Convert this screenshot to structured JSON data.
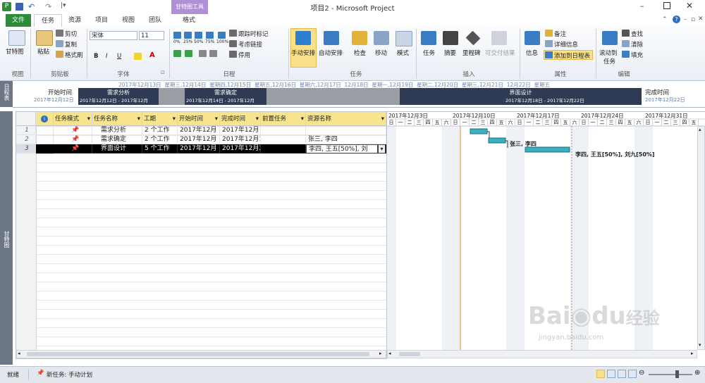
{
  "window": {
    "title": "项目2 - Microsoft Project",
    "contextual_tab_title": "甘特图工具"
  },
  "tabs": [
    "文件",
    "任务",
    "资源",
    "项目",
    "视图",
    "团队",
    "格式"
  ],
  "ribbon": {
    "view": {
      "gantt_label": "甘特图",
      "group": "视图"
    },
    "clipboard": {
      "paste": "粘贴",
      "cut": "剪切",
      "copy": "复制",
      "format_painter": "格式刷",
      "group": "剪贴板"
    },
    "font": {
      "font_name": "宋体",
      "font_size": "11",
      "bold": "B",
      "italic": "I",
      "underline": "U",
      "group": "字体"
    },
    "schedule": {
      "pct": [
        "0%",
        "25%",
        "50%",
        "75%",
        "100%"
      ],
      "track": "跟踪时标记",
      "respect_links": "考虑链接",
      "inactivate": "停用",
      "group": "日程"
    },
    "tasks": {
      "manual": "手动安排",
      "auto": "自动安排",
      "inspect": "检查",
      "move": "移动",
      "mode": "模式",
      "group": "任务"
    },
    "insert": {
      "task": "任务",
      "summary": "摘要",
      "milestone": "里程碑",
      "deliverable": "可交付结果",
      "group": "插入"
    },
    "properties": {
      "info": "信息",
      "notes": "备注",
      "details": "详细信息",
      "add_timeline": "添加到日程表",
      "group": "属性"
    },
    "editing": {
      "scroll_to_task": "滚动到",
      "scroll_to_task2": "任务",
      "find": "查找",
      "clear": "清除",
      "fill": "填充",
      "group": "编辑"
    }
  },
  "timeline": {
    "side_label": "日程表",
    "dates": [
      "2017年12月13日",
      "星期三,12月14日",
      "星期四,12月15日",
      "星期五,12月16日",
      "星期六,12月17日",
      "12月18日",
      "星期一,12月19日",
      "星期二,12月20日",
      "星期三,12月21日",
      "12月22日",
      "星期五"
    ],
    "start_label": "开始时间",
    "start_date": "2017年12月12日",
    "finish_label": "完成时间",
    "finish_date": "2017年12月22日",
    "bars": [
      {
        "name": "需求分析",
        "range": "2017年12月12日 - 2017年12月"
      },
      {
        "name": "需求确定",
        "range": "2017年12月14日 - 2017年12月"
      },
      {
        "name": "界面设计",
        "range": "2017年12月18日 - 2017年12月22日"
      }
    ]
  },
  "view_side_label": "甘特图",
  "table": {
    "headers": [
      "任务模式",
      "任务名称",
      "工期",
      "开始时间",
      "完成时间",
      "前置任务",
      "资源名称"
    ],
    "rows": [
      {
        "id": "1",
        "name": "需求分析",
        "duration": "2 个工作",
        "start": "2017年12月",
        "finish": "2017年12月",
        "pred": "",
        "resources": ""
      },
      {
        "id": "2",
        "name": "需求确定",
        "duration": "2 个工作",
        "start": "2017年12月",
        "finish": "2017年12月1",
        "pred": "",
        "resources": "张三, 李四"
      },
      {
        "id": "3",
        "name": "界面设计",
        "duration": "5 个工作",
        "start": "2017年12月",
        "finish": "2017年12月2",
        "pred": "",
        "resources": "李四, 王五[50%], 刘"
      }
    ]
  },
  "gantt": {
    "weeks": [
      "2017年12月3日",
      "2017年12月10日",
      "2017年12月17日",
      "2017年12月24日",
      "2017年12月31日"
    ],
    "days": [
      "日",
      "一",
      "二",
      "三",
      "四",
      "五",
      "六"
    ],
    "bar_labels": [
      "张三, 李四",
      "李四, 王五[50%], 刘九[50%]"
    ]
  },
  "status": {
    "ready": "就绪",
    "new_task": "新任务: 手动计划"
  },
  "watermark": {
    "brand": "Bai",
    "brand2": "du",
    "cn": "经验",
    "url": "jingyan.baidu.com"
  },
  "colors": {
    "file_tab": "#2e8b3a",
    "contextual": "#b18fd6",
    "timeline_bar": "#2f3b54",
    "gantt_bar": "#3ab0c0",
    "selected_row": "#000000",
    "header_highlight": "#f7e48c"
  }
}
